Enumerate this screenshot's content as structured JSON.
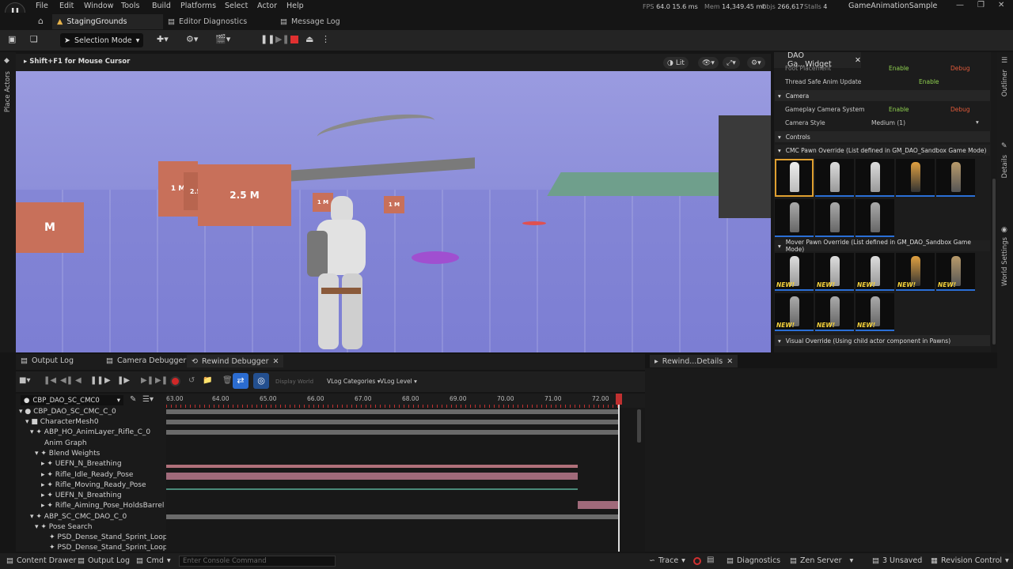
{
  "menubar": {
    "items": [
      "File",
      "Edit",
      "Window",
      "Tools",
      "Build",
      "Platforms",
      "Select",
      "Actor",
      "Help"
    ],
    "fps_label": "FPS",
    "fps": "64.0",
    "ms": "15.6 ms",
    "mem_label": "Mem",
    "mem": "14,349.45 mb",
    "objs_label": "Objs",
    "objs": "266,617",
    "stalls_label": "Stalls",
    "stalls": "4",
    "app_title": "GameAnimationSample"
  },
  "tabs": {
    "level": "StagingGrounds",
    "editor_diag": "Editor Diagnostics",
    "message_log": "Message Log"
  },
  "toolbar": {
    "mode": "Selection Mode"
  },
  "left_strip": {
    "place_actors": "Place Actors"
  },
  "viewport": {
    "hint": "Shift+F1 for Mouse Cursor",
    "lit": "Lit",
    "box_labels": [
      "1 M",
      "2.5",
      "2.5 M",
      "1 M",
      "1 M",
      "M"
    ]
  },
  "details_panel": {
    "tab": "DAO Ga...Widget",
    "foot_placement": "Foot Placement",
    "thread_safe": "Thread Safe Anim Update",
    "enable": "Enable",
    "debug": "Debug",
    "camera_section": "Camera",
    "gameplay_camera": "Gameplay Camera System",
    "camera_style": "Camera Style",
    "camera_style_value": "Medium (1)",
    "controls_section": "Controls",
    "cmc_override": "CMC Pawn Override (List defined in GM_DAO_Sandbox Game Mode)",
    "mover_override": "Mover Pawn Override (List defined in GM_DAO_Sandbox Game Mode)",
    "visual_override": "Visual Override (Using child actor component in Pawns)",
    "new_label": "NEW!"
  },
  "right_strip": {
    "outliner": "Outliner",
    "details": "Details",
    "world_settings": "World Settings"
  },
  "bottom": {
    "tabs": [
      "Output Log",
      "Camera Debugger",
      "Rewind Debugger"
    ],
    "details_tab": "Rewind...Details",
    "display_world": "Display World",
    "vlog_categories": "VLog Categories",
    "vlog_level": "VLog Level",
    "actor_select": "CBP_DAO_SC_CMC0",
    "tree": [
      "CBP_DAO_SC_CMC_C_0",
      "CharacterMesh0",
      "ABP_HO_AnimLayer_Rifle_C_0",
      "Anim Graph",
      "Blend Weights",
      "UEFN_N_Breathing",
      "Rifle_Idle_Ready_Pose",
      "Rifle_Moving_Ready_Pose",
      "UEFN_N_Breathing",
      "Rifle_Aiming_Pose_HoldsBarrel",
      "ABP_SC_CMC_DAO_C_0",
      "Pose Search",
      "PSD_Dense_Stand_Sprint_Loops -",
      "PSD_Dense_Stand_Sprint_Loops -"
    ],
    "ticks": [
      "63.00",
      "64.00",
      "65.00",
      "66.00",
      "67.00",
      "68.00",
      "69.00",
      "70.00",
      "71.00",
      "72.00"
    ]
  },
  "statusbar": {
    "content_drawer": "Content Drawer",
    "output_log": "Output Log",
    "cmd": "Cmd",
    "console_placeholder": "Enter Console Command",
    "trace": "Trace",
    "diagnostics": "Diagnostics",
    "zen": "Zen Server",
    "unsaved": "3 Unsaved",
    "revision": "Revision Control"
  }
}
